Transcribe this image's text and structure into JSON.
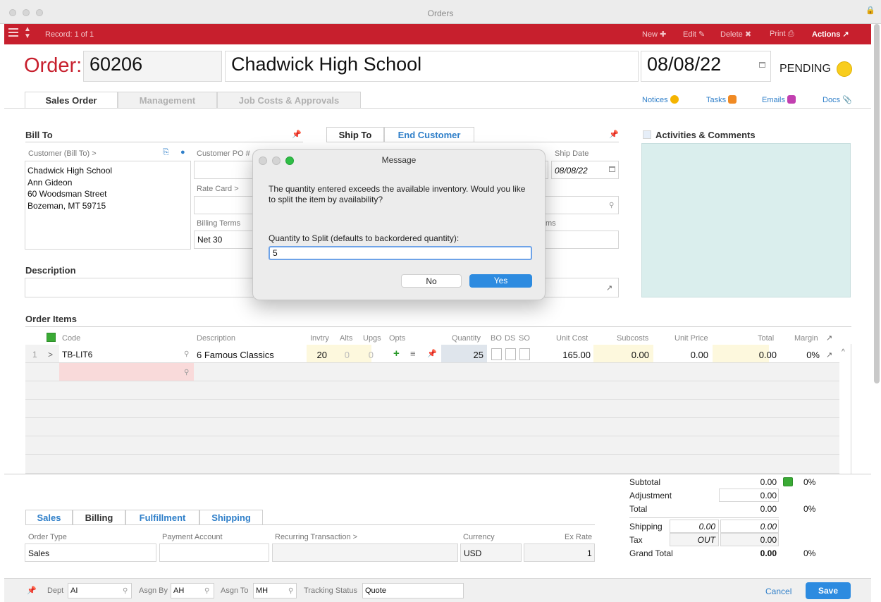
{
  "window": {
    "title": "Orders"
  },
  "toolbar": {
    "record": "Record: 1 of 1",
    "new_label": "New",
    "edit_label": "Edit",
    "delete_label": "Delete",
    "print_label": "Print",
    "actions_label": "Actions"
  },
  "header": {
    "order_label": "Order:",
    "order_number": "60206",
    "customer_name": "Chadwick High School",
    "date": "08/08/22",
    "status": "PENDING",
    "status_color": "#f8cd1e"
  },
  "tabs": [
    {
      "label": "Sales Order",
      "active": true
    },
    {
      "label": "Management",
      "active": false
    },
    {
      "label": "Job Costs & Approvals",
      "active": false
    }
  ],
  "links": {
    "notices": "Notices",
    "tasks": "Tasks",
    "emails": "Emails",
    "docs": "Docs"
  },
  "bill_to": {
    "title": "Bill To",
    "customer_label": "Customer (Bill To) >",
    "address_lines": [
      "Chadwick High School",
      "Ann Gideon",
      "60 Woodsman Street",
      "Bozeman, MT 59715"
    ],
    "customer_po_label": "Customer PO #",
    "rate_card_label": "Rate Card >",
    "billing_terms_label": "Billing Terms",
    "billing_terms_value": "Net 30"
  },
  "ship_to": {
    "tab_ship_to": "Ship To",
    "tab_end_customer": "End Customer",
    "ship_date_label": "Ship Date",
    "ship_date_value": "08/08/22",
    "partial_label": "ms"
  },
  "activities": {
    "title": "Activities & Comments"
  },
  "description": {
    "title": "Description"
  },
  "order_items": {
    "title": "Order Items",
    "columns": {
      "code": "Code",
      "description": "Description",
      "invtry": "Invtry",
      "alts": "Alts",
      "upgs": "Upgs",
      "opts": "Opts",
      "quantity": "Quantity",
      "bo": "BO",
      "ds": "DS",
      "so": "SO",
      "unit_cost": "Unit Cost",
      "subcosts": "Subcosts",
      "unit_price": "Unit Price",
      "total": "Total",
      "margin": "Margin"
    },
    "rows": [
      {
        "line": "1",
        "arrow": ">",
        "code": "TB-LIT6",
        "description": "6 Famous Classics",
        "invtry": "20",
        "alts": "0",
        "upgs": "0",
        "quantity": "25",
        "unit_cost": "165.00",
        "subcosts": "0.00",
        "unit_price": "0.00",
        "total": "0.00",
        "margin": "0%"
      }
    ]
  },
  "totals": {
    "subtotal_label": "Subtotal",
    "subtotal": "0.00",
    "subtotal_pct": "0%",
    "adjustment_label": "Adjustment",
    "adjustment": "0.00",
    "total_label": "Total",
    "total": "0.00",
    "total_pct": "0%",
    "shipping_label": "Shipping",
    "shipping_cost": "0.00",
    "shipping": "0.00",
    "tax_label": "Tax",
    "tax_code": "OUT",
    "tax": "0.00",
    "grand_total_label": "Grand Total",
    "grand_total": "0.00",
    "grand_total_pct": "0%"
  },
  "bottom_tabs": [
    {
      "label": "Sales",
      "active": false
    },
    {
      "label": "Billing",
      "active": true
    },
    {
      "label": "Fulfillment",
      "active": false
    },
    {
      "label": "Shipping",
      "active": false
    }
  ],
  "billing": {
    "order_type_label": "Order Type",
    "order_type": "Sales",
    "payment_account_label": "Payment Account",
    "recurring_label": "Recurring Transaction >",
    "currency_label": "Currency",
    "currency": "USD",
    "ex_rate_label": "Ex Rate",
    "ex_rate": "1"
  },
  "footer": {
    "dept_label": "Dept",
    "dept": "AI",
    "asgn_by_label": "Asgn By",
    "asgn_by": "AH",
    "asgn_to_label": "Asgn To",
    "asgn_to": "MH",
    "tracking_label": "Tracking Status",
    "tracking": "Quote",
    "cancel_label": "Cancel",
    "save_label": "Save"
  },
  "dialog": {
    "title": "Message",
    "message": "The quantity entered exceeds the available inventory. Would you like to split the item by availability?",
    "quantity_label": "Quantity to Split (defaults to backordered quantity):",
    "quantity_value": "5",
    "no_label": "No",
    "yes_label": "Yes"
  },
  "colors": {
    "brand_red": "#c71f2d",
    "accent_blue": "#2d8be0",
    "activities_bg": "#daeeed"
  }
}
